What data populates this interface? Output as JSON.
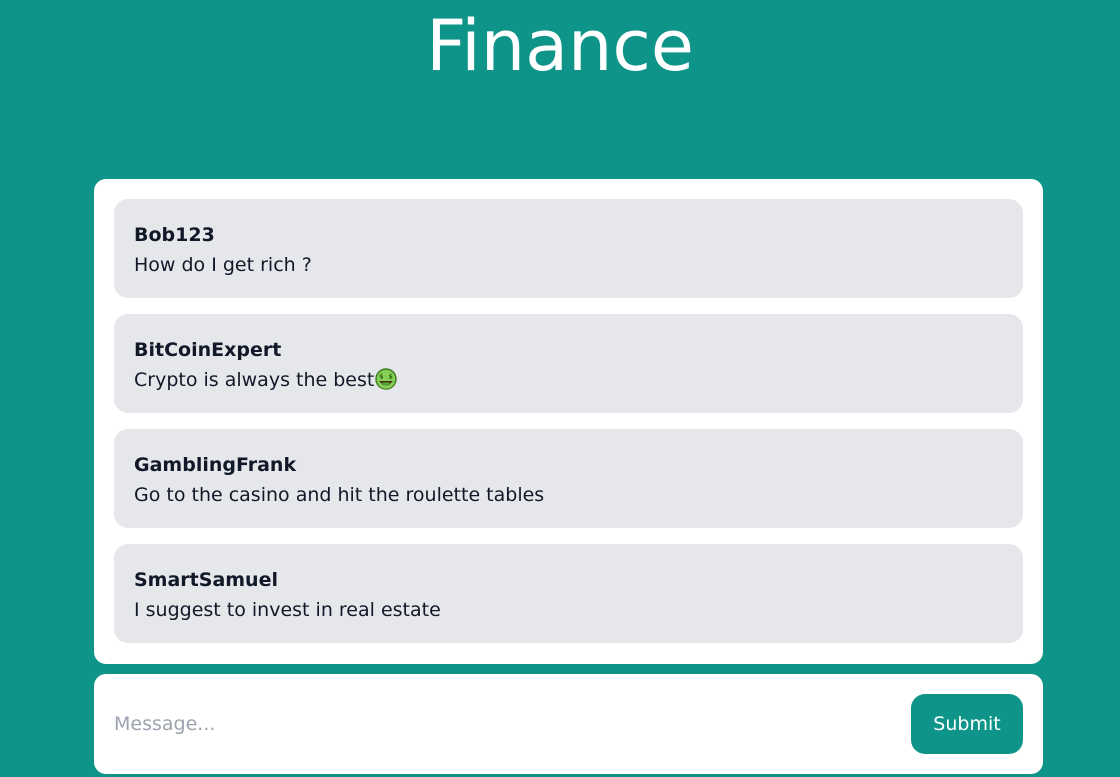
{
  "header": {
    "title": "Finance"
  },
  "messages": [
    {
      "author": "Bob123",
      "text": "How do I get rich ?"
    },
    {
      "author": "BitCoinExpert",
      "text": "Crypto is always the best",
      "emoji": "money-mouth-face-icon"
    },
    {
      "author": "GamblingFrank",
      "text": "Go to the casino and hit the roulette tables"
    },
    {
      "author": "SmartSamuel",
      "text": "I suggest to invest in real estate"
    }
  ],
  "composer": {
    "placeholder": "Message...",
    "value": "",
    "submit_label": "Submit"
  },
  "colors": {
    "accent": "#0e9488",
    "message_bg": "#e5e7eb",
    "card_bg": "#ffffff"
  }
}
